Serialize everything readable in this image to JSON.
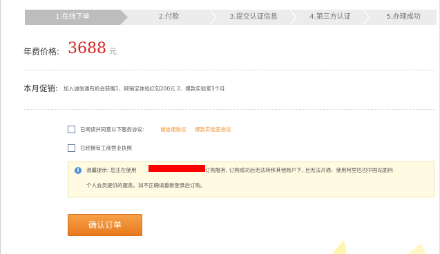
{
  "steps": [
    {
      "label": "1.在线下单",
      "active": true
    },
    {
      "label": "2.付款",
      "active": false
    },
    {
      "label": "3.提交认证信息",
      "active": false
    },
    {
      "label": "4.第三方认证",
      "active": false
    },
    {
      "label": "5.办理成功",
      "active": false
    }
  ],
  "price": {
    "label": "年费价格:",
    "value": "3688",
    "unit": "元"
  },
  "promo": {
    "label": "本月促销:",
    "text": "加入诚信通有机会获赠1、网销宝体验红包200元  2、爆款实验室3个月"
  },
  "agreement": {
    "label": "已阅读并同意以下服务协议:",
    "link1": "诚信通协议",
    "link2": "爆款实验室协议",
    "checked": false
  },
  "license": {
    "label": "已经拥有工商营业执照",
    "checked": false
  },
  "notice": {
    "icon": "info-icon",
    "line1_prefix": "温馨提示: 您正在使用",
    "line1_suffix": "订购服务, 订购成功后无法转移其他账户下, 且无法开通、使用阿里巴巴中国站面向",
    "line2": "个人会员提供的服务。如不正确请重新登录后订购。"
  },
  "submit_label": "确认订单",
  "colors": {
    "price": "#d32121",
    "link": "#f08a24",
    "button": "#f08a24",
    "notice_bg": "#fffbe2",
    "step_active": "#bdbdbd"
  }
}
